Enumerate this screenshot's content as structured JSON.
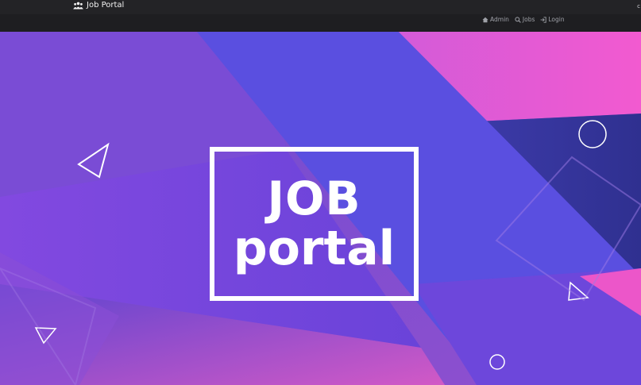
{
  "brand": {
    "title": "Job Portal",
    "icon": "people-group-icon"
  },
  "nav": {
    "items": [
      {
        "label": "Admin",
        "icon": "home-icon"
      },
      {
        "label": "Jobs",
        "icon": "search-icon"
      },
      {
        "label": "Login",
        "icon": "login-icon"
      }
    ]
  },
  "hero": {
    "logo_line1": "JOB",
    "logo_line2": "portal"
  },
  "colors": {
    "topbar": "#1e1e21",
    "purple": "#7f4fd8",
    "indigo": "#5147d8",
    "pink": "#ee55c8",
    "navy": "#3a33a0"
  }
}
